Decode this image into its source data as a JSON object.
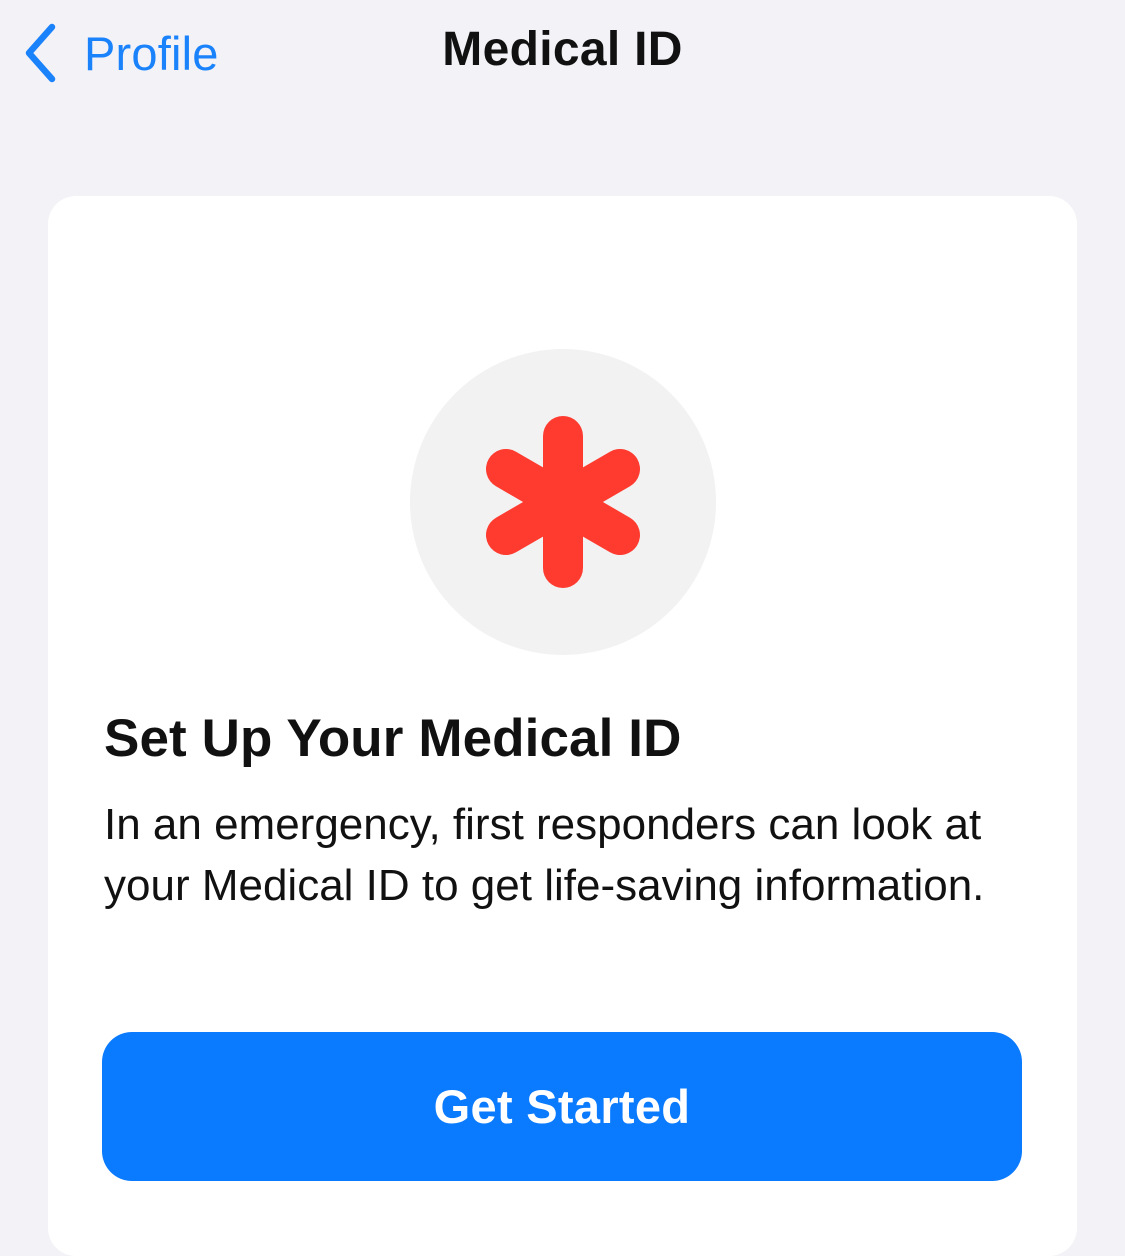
{
  "nav": {
    "back_label": "Profile",
    "title": "Medical ID",
    "back_icon": "chevron-left-icon"
  },
  "card": {
    "icon": "medical-asterisk-icon",
    "title": "Set Up Your Medical ID",
    "description": "In an emergency, first responders can look at your Medical ID to get life-saving information.",
    "button_label": "Get Started"
  },
  "colors": {
    "background": "#f2f2f7",
    "accent": "#0a7aff",
    "link": "#1a82fb",
    "asterisk": "#ff3b30",
    "icon_circle": "#f2f2f2"
  }
}
